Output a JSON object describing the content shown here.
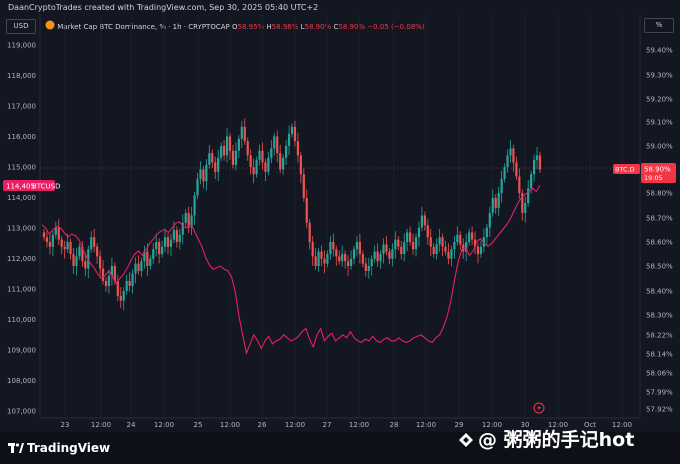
{
  "caption": "DaanCryptoTrades created with TradingView.com, Sep 30, 2025 05:40 UTC+2",
  "left_scale_label": "USD",
  "right_scale_label": "%",
  "legend": {
    "symbol": "Market Cap BTC Dominance, % · 1h · CRYPTOCAP",
    "o_key": "O",
    "o_val": "58.95%",
    "h_key": "H",
    "h_val": "58.96%",
    "l_key": "L",
    "l_val": "58.90%",
    "c_key": "C",
    "c_val": "58.90%",
    "change": "−0.05 (−0.08%)"
  },
  "btcusd_tag": {
    "value": "114,405",
    "label": "BTCUSD"
  },
  "btcd_tag": {
    "label": "BTC.D",
    "value": "58.90%",
    "countdown": "19:05"
  },
  "footer": {
    "logo": "TradingView"
  },
  "watermark": "@ 粥粥的手记hot",
  "colors": {
    "up": "#26a69a",
    "down": "#ef5350",
    "btc_line": "#e91e63",
    "bg": "#131722"
  },
  "chart_data": {
    "type": "candlestick+line",
    "x_ticks": [
      "23",
      "12:00",
      "24",
      "12:00",
      "25",
      "12:00",
      "26",
      "12:00",
      "27",
      "12:00",
      "28",
      "12:00",
      "29",
      "12:00",
      "30",
      "12:00",
      "Oct",
      "12:00"
    ],
    "left_axis": {
      "label": "USD",
      "ticks": [
        "119,000",
        "118,000",
        "117,000",
        "116,000",
        "115,000",
        "114,000",
        "113,000",
        "112,000",
        "111,000",
        "110,000",
        "109,000",
        "108,000",
        "107,000"
      ],
      "range": [
        107000,
        119000
      ]
    },
    "right_axis": {
      "label": "%",
      "ticks": [
        "59.40%",
        "59.30%",
        "59.20%",
        "59.10%",
        "59.00%",
        "58.80%",
        "58.70%",
        "58.60%",
        "58.50%",
        "58.40%",
        "58.30%",
        "58.22%",
        "58.14%",
        "58.06%",
        "57.99%",
        "57.92%"
      ]
    },
    "series": [
      {
        "name": "Market Cap BTC Dominance, %",
        "style": "candles",
        "scale": "right",
        "close": [
          58.62,
          58.6,
          58.58,
          58.63,
          58.66,
          58.61,
          58.58,
          58.57,
          58.6,
          58.55,
          58.5,
          58.54,
          58.58,
          58.52,
          58.49,
          58.57,
          58.62,
          58.58,
          58.54,
          58.49,
          58.44,
          58.42,
          58.46,
          58.5,
          58.44,
          58.38,
          58.36,
          58.4,
          58.44,
          58.42,
          58.47,
          58.51,
          58.48,
          58.52,
          58.56,
          58.5,
          58.53,
          58.57,
          58.6,
          58.55,
          58.58,
          58.62,
          58.58,
          58.61,
          58.65,
          58.6,
          58.63,
          58.68,
          58.72,
          58.66,
          58.71,
          58.79,
          58.86,
          58.9,
          58.85,
          58.92,
          58.97,
          58.93,
          58.89,
          58.95,
          59,
          58.96,
          59.04,
          58.98,
          58.92,
          58.98,
          59.03,
          59.08,
          59.02,
          58.96,
          58.91,
          58.88,
          58.94,
          58.98,
          58.93,
          58.89,
          58.95,
          58.99,
          59.04,
          58.97,
          58.9,
          58.95,
          59,
          59.05,
          59.08,
          59.02,
          58.96,
          58.88,
          58.78,
          58.68,
          58.6,
          58.54,
          58.5,
          58.56,
          58.53,
          58.51,
          58.55,
          58.6,
          58.57,
          58.54,
          58.52,
          58.55,
          58.52,
          58.5,
          58.53,
          58.57,
          58.6,
          58.55,
          58.51,
          58.48,
          58.5,
          58.53,
          58.56,
          58.52,
          58.55,
          58.59,
          58.56,
          58.53,
          58.57,
          58.61,
          58.58,
          58.55,
          58.6,
          58.64,
          58.6,
          58.57,
          58.62,
          58.66,
          58.71,
          58.67,
          58.62,
          58.58,
          58.55,
          58.59,
          58.62,
          58.58,
          58.56,
          58.53,
          58.57,
          58.6,
          58.63,
          58.59,
          58.56,
          58.6,
          58.64,
          58.61,
          58.58,
          58.55,
          58.58,
          58.62,
          58.66,
          58.72,
          58.78,
          58.74,
          58.8,
          58.86,
          58.91,
          58.96,
          58.99,
          58.93,
          58.87,
          58.8,
          58.72,
          58.76,
          58.82,
          58.88,
          58.94,
          58.96,
          58.9
        ],
        "high_first": 58.66,
        "low_first": 58.58
      },
      {
        "name": "BTCUSD",
        "style": "line",
        "scale": "left",
        "values": [
          113100,
          113000,
          112800,
          112950,
          113050,
          113000,
          112850,
          112700,
          112800,
          112750,
          112600,
          112300,
          112050,
          111850,
          111700,
          111500,
          111350,
          111450,
          111600,
          111400,
          111200,
          111350,
          111500,
          111700,
          111950,
          112150,
          112250,
          112100,
          112300,
          112500,
          112650,
          112800,
          112900,
          112950,
          112850,
          113000,
          113150,
          113200,
          113050,
          113000,
          113150,
          112900,
          112650,
          112400,
          112050,
          111800,
          111650,
          111700,
          111750,
          111650,
          111600,
          111400,
          110900,
          110100,
          109500,
          108900,
          109200,
          109500,
          109300,
          109050,
          109300,
          109450,
          109200,
          109300,
          109350,
          109500,
          109400,
          109300,
          109350,
          109450,
          109600,
          109700,
          109350,
          109100,
          109500,
          109700,
          109300,
          109450,
          109550,
          109300,
          109400,
          109500,
          109400,
          109600,
          109400,
          109300,
          109250,
          109350,
          109300,
          109450,
          109300,
          109250,
          109350,
          109400,
          109300,
          109300,
          109400,
          109300,
          109250,
          109300,
          109400,
          109450,
          109500,
          109400,
          109300,
          109250,
          109400,
          109500,
          109750,
          110100,
          110600,
          111300,
          111900,
          112300,
          112350,
          112100,
          112250,
          112550,
          112650,
          112500,
          112400,
          112500,
          112650,
          112800,
          112950,
          113100,
          113300,
          113550,
          113800,
          114000,
          114100,
          114200,
          114300,
          114200,
          114405
        ]
      }
    ]
  }
}
